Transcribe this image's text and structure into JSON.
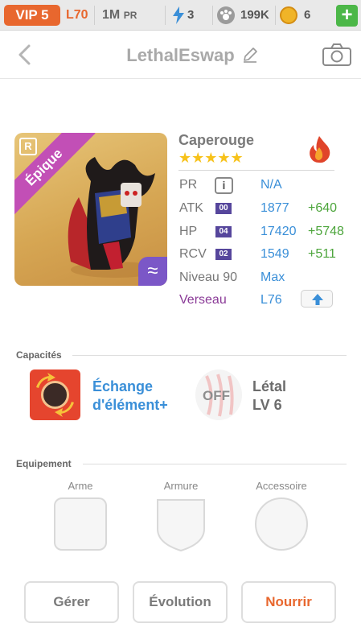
{
  "topbar": {
    "vip": "VIP 5",
    "level": "L70",
    "pr_value": "1M",
    "pr_unit": "PR",
    "stamina": "3",
    "paw_value": "199K",
    "coins": "6",
    "plus_label": "+"
  },
  "header": {
    "title": "LethalEswap"
  },
  "card": {
    "rarity": "Épique",
    "badge": "R",
    "element_symbol": "≈"
  },
  "monster": {
    "name": "Caperouge",
    "stars": "★★★★★",
    "stats": {
      "pr_label": "PR",
      "pr_value": "N/A",
      "info_label": "i",
      "atk_label": "ATK",
      "atk_tag": "00",
      "atk_value": "1877",
      "atk_bonus": "+640",
      "hp_label": "HP",
      "hp_tag": "04",
      "hp_value": "17420",
      "hp_bonus": "+5748",
      "rcv_label": "RCV",
      "rcv_tag": "02",
      "rcv_value": "1549",
      "rcv_bonus": "+511",
      "level_label": "Niveau 90",
      "level_value": "Max",
      "sign_label": "Verseau",
      "sign_value": "L76"
    }
  },
  "abilities": {
    "section_title": "Capacités",
    "ability1_line1": "Échange",
    "ability1_line2": "d'élément+",
    "ability2_state": "OFF",
    "ability2_line1": "Létal",
    "ability2_line2": "LV 6"
  },
  "equipment": {
    "section_title": "Equipement",
    "slot1": "Arme",
    "slot2": "Armure",
    "slot3": "Accessoire"
  },
  "actions": {
    "manage": "Gérer",
    "evolution": "Évolution",
    "feed": "Nourrir"
  },
  "colors": {
    "accent": "#e8672e",
    "value_blue": "#3a8fd8",
    "bonus_green": "#4ca53b",
    "epic_purple": "#c24fb6",
    "star_yellow": "#f7c21a"
  }
}
